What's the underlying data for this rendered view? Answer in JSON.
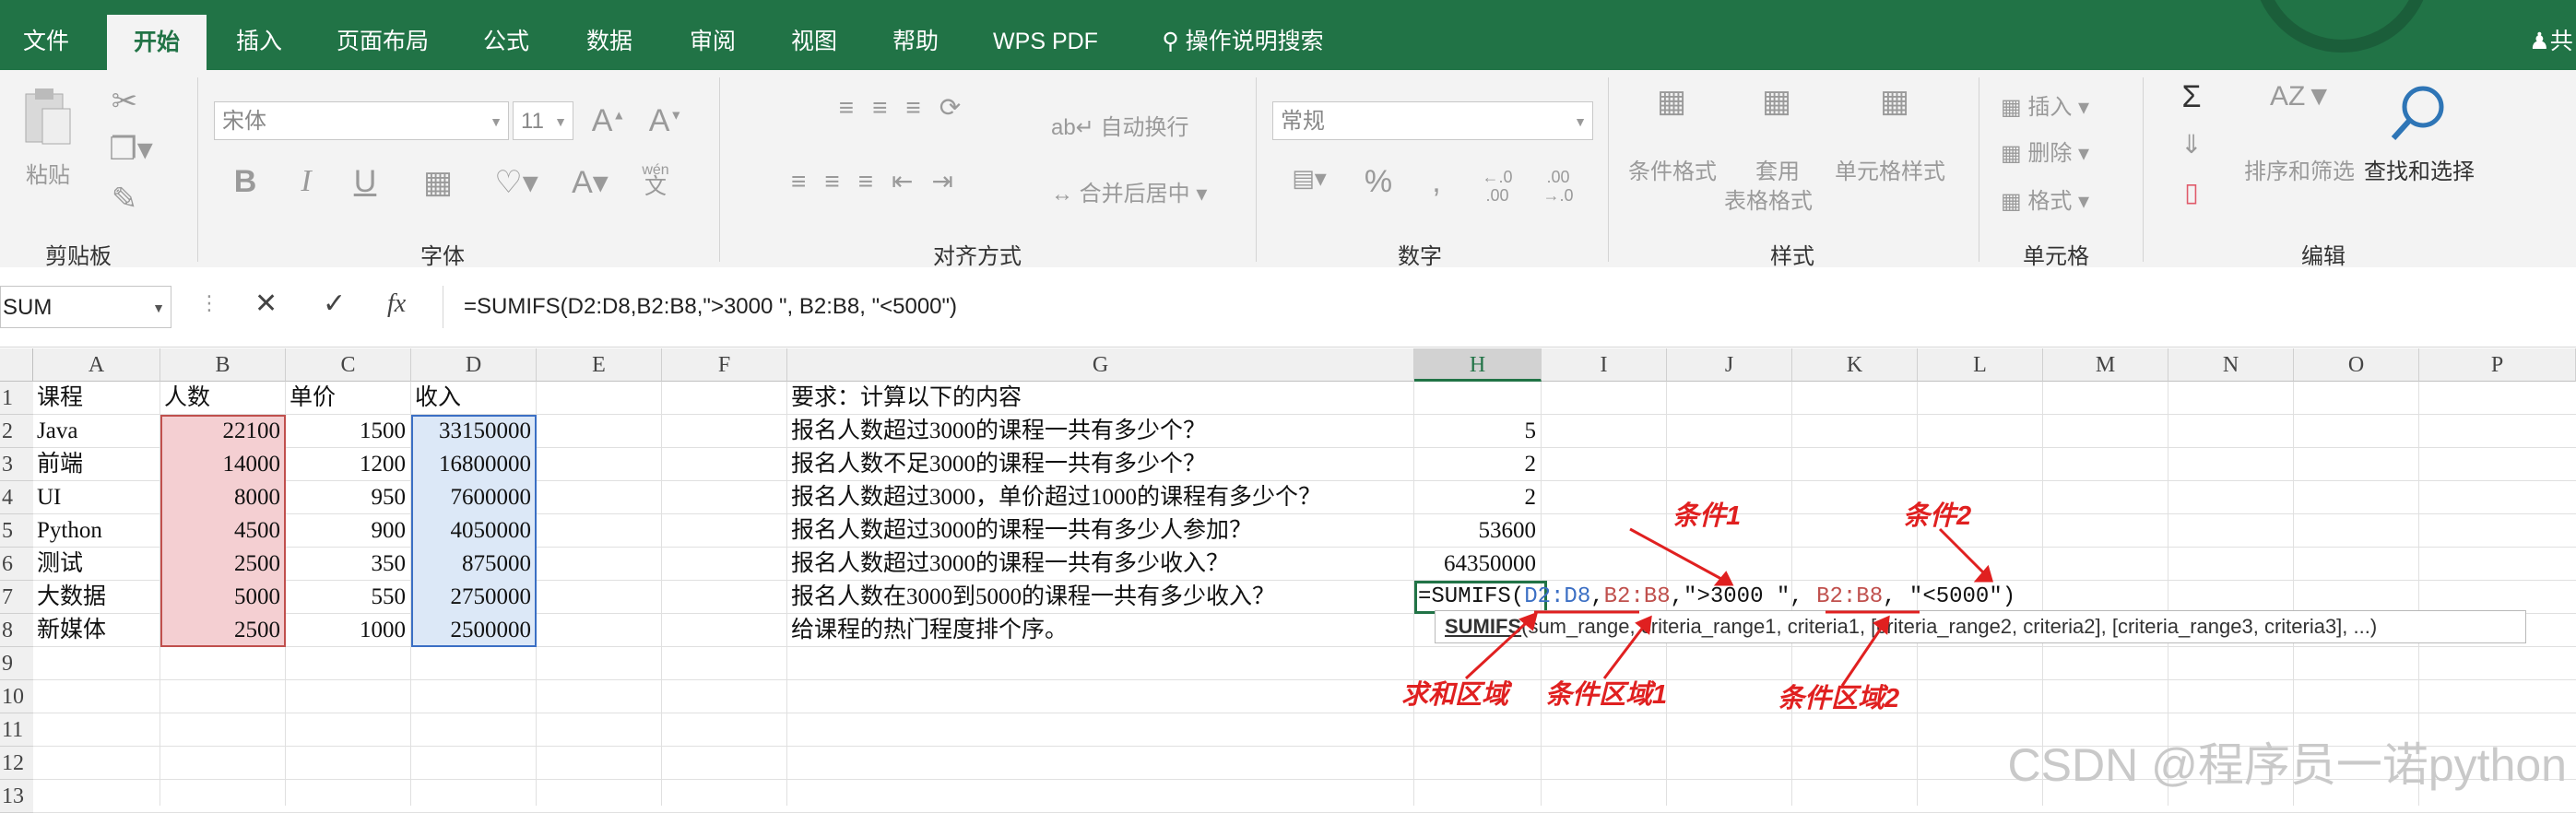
{
  "menu": {
    "tabs": [
      "文件",
      "开始",
      "插入",
      "页面布局",
      "公式",
      "数据",
      "审阅",
      "视图",
      "帮助",
      "WPS PDF"
    ],
    "active": "开始",
    "search_label": "操作说明搜索",
    "share_label": "共"
  },
  "ribbon": {
    "groups": [
      "剪贴板",
      "字体",
      "对齐方式",
      "数字",
      "样式",
      "单元格",
      "编辑"
    ],
    "paste_label": "粘贴",
    "font_name": "宋体",
    "font_size": "11",
    "wrap_text": "自动换行",
    "merge_center": "合并后居中",
    "number_format": "常规",
    "conditional_format": "条件格式",
    "table_format_1": "套用",
    "table_format_2": "表格格式",
    "cell_styles": "单元格样式",
    "insert": "插入",
    "delete": "删除",
    "format": "格式",
    "sort_filter": "排序和筛选",
    "find_select": "查找和选择",
    "wen_label": "wén",
    "wen_char": "文",
    "dec_inc": ".00",
    "dec_dec": ".00"
  },
  "formula_bar": {
    "name_box": "SUM",
    "fx": "fx",
    "formula": "=SUMIFS(D2:D8,B2:B8,\">3000 \", B2:B8, \"<5000\")"
  },
  "columns": [
    "A",
    "B",
    "C",
    "D",
    "E",
    "F",
    "G",
    "H",
    "I",
    "J",
    "K",
    "L",
    "M",
    "N",
    "O",
    "P"
  ],
  "rows": [
    "1",
    "2",
    "3",
    "4",
    "5",
    "6",
    "7",
    "8",
    "9",
    "10",
    "11",
    "12",
    "13"
  ],
  "sheet": {
    "headers": {
      "a": "课程",
      "b": "人数",
      "c": "单价",
      "d": "收入"
    },
    "data": [
      {
        "a": "Java",
        "b": "22100",
        "c": "1500",
        "d": "33150000"
      },
      {
        "a": "前端",
        "b": "14000",
        "c": "1200",
        "d": "16800000"
      },
      {
        "a": "UI",
        "b": "8000",
        "c": "950",
        "d": "7600000"
      },
      {
        "a": "Python",
        "b": "4500",
        "c": "900",
        "d": "4050000"
      },
      {
        "a": "测试",
        "b": "2500",
        "c": "350",
        "d": "875000"
      },
      {
        "a": "大数据",
        "b": "5000",
        "c": "550",
        "d": "2750000"
      },
      {
        "a": "新媒体",
        "b": "2500",
        "c": "1000",
        "d": "2500000"
      }
    ],
    "questions": [
      "要求：计算以下的内容",
      "报名人数超过3000的课程一共有多少个？",
      "报名人数不足3000的课程一共有多少个？",
      "报名人数超过3000，单价超过1000的课程有多少个？",
      "报名人数超过3000的课程一共有多少人参加？",
      "报名人数超过3000的课程一共有多少收入？",
      "报名人数在3000到5000的课程一共有多少收入？",
      "给课程的热门程度排个序。"
    ],
    "answers": [
      "5",
      "2",
      "2",
      "53600",
      "64350000"
    ]
  },
  "editing": {
    "p1": "=SUMIFS(",
    "p2": "D2:D8",
    "p3": ",",
    "p4": "B2:B8",
    "p5": ",\">3000 \", ",
    "p6": "B2:B8",
    "p7": ", \"<5000\")",
    "tooltip_fn": "SUMIFS",
    "tooltip_args": "(sum_range, criteria_range1, criteria1, [criteria_range2, criteria2], [criteria_range3, criteria3], ...)"
  },
  "annotations": {
    "cond1": "条件1",
    "cond2": "条件2",
    "sum_range": "求和区域",
    "crit_range1": "条件区域1",
    "crit_range2": "条件区域2"
  },
  "watermark": "CSDN @程序员一诺python",
  "colors": {
    "excel_green": "#217346",
    "annotation_red": "#e02020",
    "ref_blue": "#3b6fc4",
    "ref_red": "#c0504d"
  }
}
